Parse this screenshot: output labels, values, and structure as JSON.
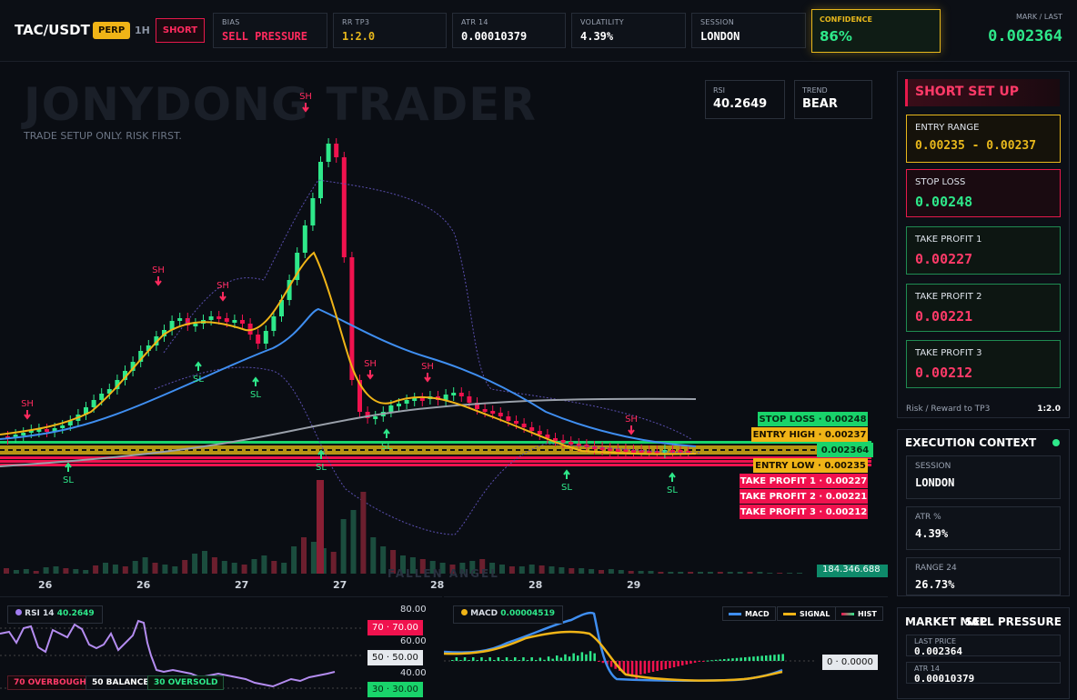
{
  "header": {
    "symbol": "TAC/USDT",
    "perp_badge": "PERP",
    "timeframe": "1H",
    "direction_button": "SHORT",
    "stats": [
      {
        "label": "BIAS",
        "value": "SELL PRESSURE",
        "color": "#ff2a5e"
      },
      {
        "label": "RR TP3",
        "value": "1:2.0",
        "color": "#e8b81c"
      },
      {
        "label": "ATR 14",
        "value": "0.00010379",
        "color": "#ffffff"
      },
      {
        "label": "VOLATILITY",
        "value": "4.39%",
        "color": "#ffffff"
      },
      {
        "label": "SESSION",
        "value": "LONDON",
        "color": "#ffffff"
      }
    ],
    "confidence": {
      "label": "CONFIDENCE",
      "value": "86%"
    },
    "mark": {
      "label": "MARK / LAST",
      "value": "0.002364"
    }
  },
  "chart": {
    "watermark": "JONYDONG TRADER",
    "watermark_sub": "TRADE SETUP ONLY. RISK FIRST.",
    "footer_watermark": "FALLEN ANGEL",
    "rsi_box": {
      "label": "RSI",
      "value": "40.2649"
    },
    "trend_box": {
      "label": "TREND",
      "value": "BEAR"
    },
    "marker_sh": "SH",
    "marker_sl": "SL",
    "volume_label": "184.346.688",
    "dates": [
      "26",
      "26",
      "27",
      "27",
      "28",
      "28",
      "29"
    ],
    "price_labels": [
      {
        "text": "STOP LOSS · 0.00248",
        "bg": "#19d46b",
        "fg": "#062a14"
      },
      {
        "text": "ENTRY HIGH · 0.00237",
        "bg": "#f0b417",
        "fg": "#1a1100"
      },
      {
        "text": "ENTRY LOW · 0.00235",
        "bg": "#f0b417",
        "fg": "#1a1100"
      },
      {
        "text": "TAKE PROFIT 1 · 0.00227",
        "bg": "#f0124e",
        "fg": "#ffffff"
      },
      {
        "text": "TAKE PROFIT 2 · 0.00221",
        "bg": "#f0124e",
        "fg": "#ffffff"
      },
      {
        "text": "TAKE PROFIT 3 · 0.00212",
        "bg": "#f0124e",
        "fg": "#ffffff"
      }
    ],
    "last_price_label": "0.002364"
  },
  "setup": {
    "title": "SHORT SET UP",
    "cards": [
      {
        "label": "ENTRY RANGE",
        "value": "0.00235 - 0.00237",
        "border": "#e8b81c",
        "color": "#e8b81c"
      },
      {
        "label": "STOP LOSS",
        "value": "0.00248",
        "border": "#e6194b",
        "color": "#2ee88a"
      },
      {
        "label": "TAKE PROFIT 1",
        "value": "0.00227",
        "border": "#1f8b52",
        "color": "#ff3a68"
      },
      {
        "label": "TAKE PROFIT 2",
        "value": "0.00221",
        "border": "#1f8b52",
        "color": "#ff3a68"
      },
      {
        "label": "TAKE PROFIT 3",
        "value": "0.00212",
        "border": "#1f8b52",
        "color": "#ff3a68"
      }
    ],
    "rr_label": "Risk / Reward to TP3",
    "rr_value": "1:2.0"
  },
  "execution": {
    "title": "EXECUTION CONTEXT",
    "cards": [
      {
        "label": "SESSION",
        "value": "LONDON"
      },
      {
        "label": "ATR %",
        "value": "4.39%"
      },
      {
        "label": "RANGE 24",
        "value": "26.73%"
      }
    ]
  },
  "market_map": {
    "title": "MARKET MAP",
    "pressure": "SELL PRESSURE",
    "rows": [
      {
        "label": "LAST PRICE",
        "value": "0.002364"
      },
      {
        "label": "ATR 14",
        "value": "0.00010379"
      }
    ]
  },
  "rsi_panel": {
    "title": "RSI 14",
    "value": "40.2649",
    "overbought": "70 OVERBOUGHT",
    "balance": "50 BALANCE",
    "oversold": "30 OVERSOLD",
    "axis": [
      "80.00",
      "60.00",
      "40.00"
    ],
    "pill_70": "70 · 70.00",
    "pill_50": "50 · 50.00",
    "pill_30": "30 · 30.00"
  },
  "macd_panel": {
    "title": "MACD",
    "value": "0.00004519",
    "legend": [
      "MACD",
      "SIGNAL",
      "HIST"
    ],
    "zero_pill": "0 · 0.0000"
  },
  "colors": {
    "green": "#2ee88a",
    "red": "#f0124e",
    "yellow": "#f0b417",
    "blue": "#3f8ef0"
  }
}
